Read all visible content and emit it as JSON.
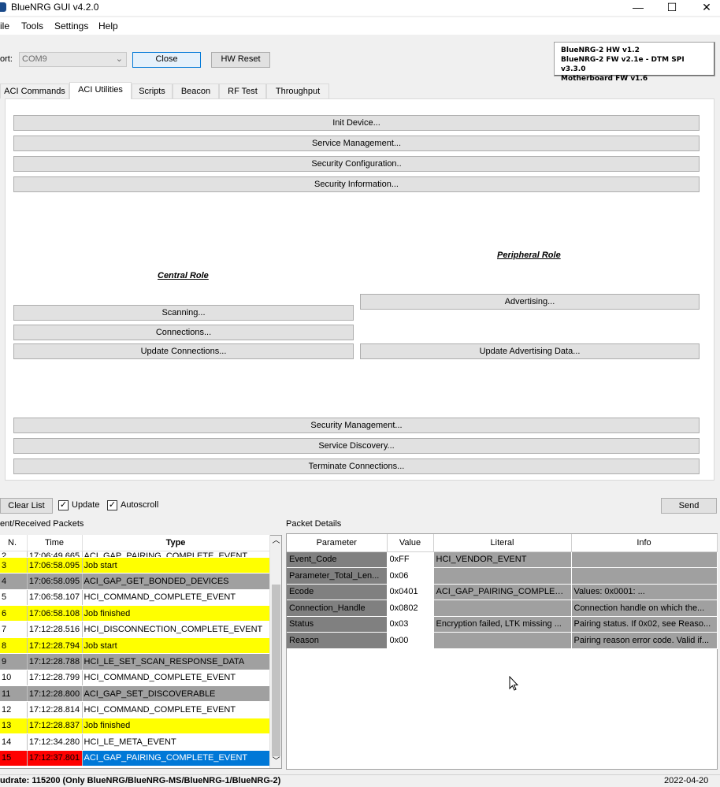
{
  "window": {
    "title": "BlueNRG GUI v4.2.0",
    "minimize": "—",
    "maximize": "☐",
    "close": "✕"
  },
  "menu": [
    "ile",
    "Tools",
    "Settings",
    "Help"
  ],
  "connection": {
    "port_label": "ort:",
    "port_value": "COM9",
    "close_label": "Close",
    "hw_reset_label": "HW Reset"
  },
  "version": {
    "line1": "BlueNRG-2 HW v1.2",
    "line2": "BlueNRG-2 FW v2.1e - DTM SPI v3.3.0",
    "line3": "Motherboard FW v1.6"
  },
  "tabs": [
    "ACI Commands",
    "ACI Utilities",
    "Scripts",
    "Beacon",
    "RF Test",
    "Throughput"
  ],
  "utilities": {
    "top_buttons": [
      "Init Device...",
      "Service Management...",
      "Security Configuration..",
      "Security Information..."
    ],
    "central_role": "Central Role",
    "peripheral_role": "Peripheral Role",
    "central_buttons": [
      "Scanning...",
      "Connections...",
      "Update Connections..."
    ],
    "peripheral_buttons": [
      "Advertising...",
      "Update Advertising  Data..."
    ],
    "bottom_buttons": [
      "Security Management...",
      "Service Discovery...",
      "Terminate Connections..."
    ]
  },
  "controls": {
    "clear_list": "Clear List",
    "update": "Update",
    "autoscroll": "Autoscroll",
    "send": "Send",
    "checkmark": "✓"
  },
  "packets": {
    "title": "ent/Received Packets",
    "headers": [
      "N.",
      "Time",
      "Type"
    ],
    "rows": [
      {
        "n": "2",
        "time": "17:06:49.665",
        "type": "ACI_GAP_PAIRING_COMPLETE_EVENT",
        "color": "white"
      },
      {
        "n": "3",
        "time": "17:06:58.095",
        "type": "Job start",
        "color": "yellow"
      },
      {
        "n": "4",
        "time": "17:06:58.095",
        "type": "ACI_GAP_GET_BONDED_DEVICES",
        "color": "gray"
      },
      {
        "n": "5",
        "time": "17:06:58.107",
        "type": "HCI_COMMAND_COMPLETE_EVENT",
        "color": "white"
      },
      {
        "n": "6",
        "time": "17:06:58.108",
        "type": "Job finished",
        "color": "yellow"
      },
      {
        "n": "7",
        "time": "17:12:28.516",
        "type": "HCI_DISCONNECTION_COMPLETE_EVENT",
        "color": "white"
      },
      {
        "n": "8",
        "time": "17:12:28.794",
        "type": "Job start",
        "color": "yellow"
      },
      {
        "n": "9",
        "time": "17:12:28.788",
        "type": "HCI_LE_SET_SCAN_RESPONSE_DATA",
        "color": "gray"
      },
      {
        "n": "10",
        "time": "17:12:28.799",
        "type": "HCI_COMMAND_COMPLETE_EVENT",
        "color": "white"
      },
      {
        "n": "11",
        "time": "17:12:28.800",
        "type": "ACI_GAP_SET_DISCOVERABLE",
        "color": "gray"
      },
      {
        "n": "12",
        "time": "17:12:28.814",
        "type": "HCI_COMMAND_COMPLETE_EVENT",
        "color": "white"
      },
      {
        "n": "13",
        "time": "17:12:28.837",
        "type": "Job finished",
        "color": "yellow"
      },
      {
        "n": "14",
        "time": "17:12:34.280",
        "type": "HCI_LE_META_EVENT",
        "color": "white"
      },
      {
        "n": "15",
        "time": "17:12:37.801",
        "type": "ACI_GAP_PAIRING_COMPLETE_EVENT",
        "color": "red"
      }
    ]
  },
  "details": {
    "title": "Packet Details",
    "headers": [
      "Parameter",
      "Value",
      "Literal",
      "Info"
    ],
    "rows": [
      {
        "param": "Event_Code",
        "value": "0xFF",
        "literal": "HCI_VENDOR_EVENT",
        "info": ""
      },
      {
        "param": "Parameter_Total_Len...",
        "value": "0x06",
        "literal": "",
        "info": ""
      },
      {
        "param": "Ecode",
        "value": "0x0401",
        "literal": "ACI_GAP_PAIRING_COMPLETE...",
        "info": " Values: 0x0001: ..."
      },
      {
        "param": "Connection_Handle",
        "value": "0x0802",
        "literal": "",
        "info": "Connection handle on which the..."
      },
      {
        "param": "Status",
        "value": "0x03",
        "literal": "Encryption failed, LTK missing ...",
        "info": "Pairing status. If 0x02, see Reaso..."
      },
      {
        "param": "Reason",
        "value": "0x00",
        "literal": "",
        "info": "Pairing reason error code. Valid if..."
      }
    ]
  },
  "status": {
    "baudrate": "udrate: 115200 (Only BlueNRG/BlueNRG-MS/BlueNRG-1/BlueNRG-2)",
    "date": "2022-04-20"
  }
}
